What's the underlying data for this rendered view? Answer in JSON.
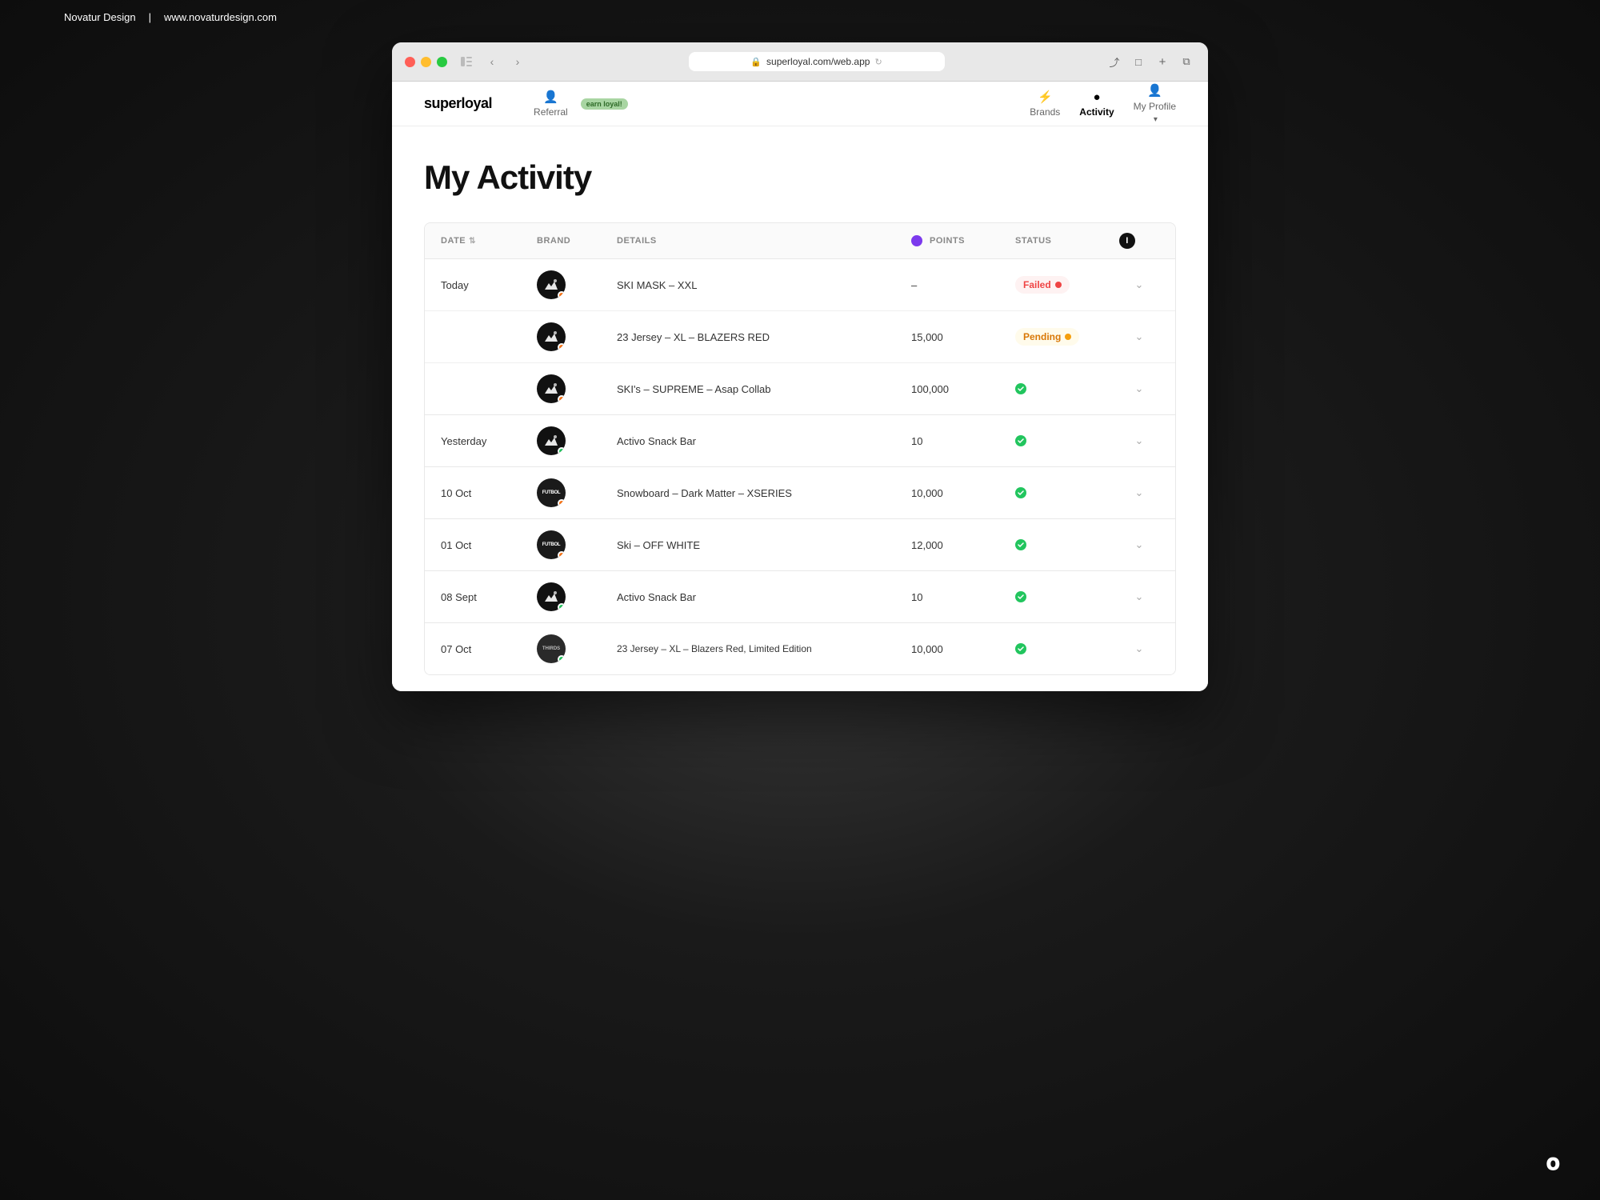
{
  "watermark": {
    "brand": "Novatur Design",
    "divider": "|",
    "url": "www.novaturdesign.com"
  },
  "browser": {
    "url": "superloyal.com/web.app",
    "back_icon": "‹",
    "forward_icon": "›"
  },
  "nav": {
    "logo": "superloyal",
    "referral_label": "Referral",
    "earn_badge": "earn loyal!",
    "brands_label": "Brands",
    "activity_label": "Activity",
    "my_profile_label": "My Profile"
  },
  "page": {
    "title": "My Activity"
  },
  "table": {
    "headers": {
      "date": "DATE",
      "brand": "BRAND",
      "details": "DETAILS",
      "points": "POINTS",
      "status": "STATUS"
    },
    "groups": [
      {
        "date": "Today",
        "rows": [
          {
            "brand_type": "mountain",
            "details": "SKI MASK – XXL",
            "points": "–",
            "status": "failed",
            "status_label": "Failed"
          },
          {
            "brand_type": "mountain",
            "details": "23 Jersey – XL – BLAZERS RED",
            "points": "15,000",
            "status": "pending",
            "status_label": "Pending"
          },
          {
            "brand_type": "mountain",
            "details": "SKI's – SUPREME – Asap Collab",
            "points": "100,000",
            "status": "success",
            "status_label": ""
          }
        ]
      },
      {
        "date": "Yesterday",
        "rows": [
          {
            "brand_type": "mountain",
            "details": "Activo Snack Bar",
            "points": "10",
            "status": "success",
            "status_label": ""
          }
        ]
      },
      {
        "date": "10 Oct",
        "rows": [
          {
            "brand_type": "futbol",
            "details": "Snowboard – Dark Matter – XSERIES",
            "points": "10,000",
            "status": "success",
            "status_label": ""
          }
        ]
      },
      {
        "date": "01 Oct",
        "rows": [
          {
            "brand_type": "futbol",
            "details": "Ski – OFF WHITE",
            "points": "12,000",
            "status": "success",
            "status_label": ""
          }
        ]
      },
      {
        "date": "08 Sept",
        "rows": [
          {
            "brand_type": "mountain",
            "details": "Activo Snack Bar",
            "points": "10",
            "status": "success",
            "status_label": ""
          }
        ]
      },
      {
        "date": "07 Oct",
        "rows": [
          {
            "brand_type": "thirds",
            "details": "23 Jersey – XL – Blazers Red, Limited Edition",
            "points": "10,000",
            "status": "success",
            "status_label": ""
          }
        ]
      }
    ]
  }
}
